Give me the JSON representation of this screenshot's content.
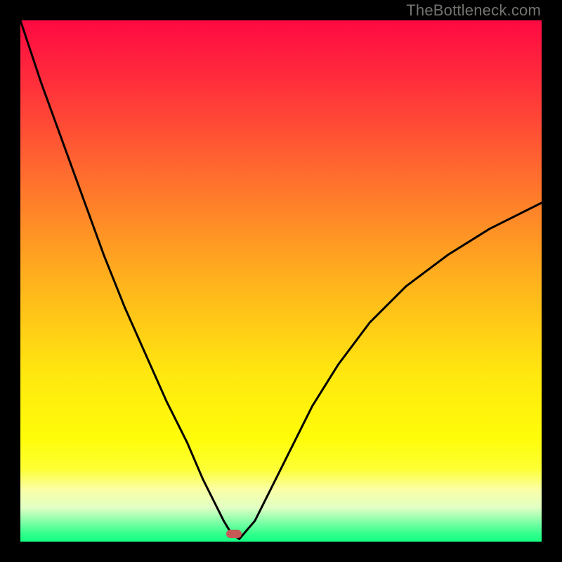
{
  "watermark": "TheBottleneck.com",
  "colors": {
    "frame": "#000000",
    "marker_fill": "#c55a57",
    "curve_stroke": "#000000",
    "gradient_stops": [
      {
        "offset": 0.0,
        "color": "#ff0942"
      },
      {
        "offset": 0.12,
        "color": "#ff2f3b"
      },
      {
        "offset": 0.3,
        "color": "#ff6e2e"
      },
      {
        "offset": 0.5,
        "color": "#ffb21d"
      },
      {
        "offset": 0.68,
        "color": "#ffe80f"
      },
      {
        "offset": 0.8,
        "color": "#fffc09"
      },
      {
        "offset": 0.86,
        "color": "#fdff33"
      },
      {
        "offset": 0.9,
        "color": "#faffa6"
      },
      {
        "offset": 0.935,
        "color": "#e1ffc4"
      },
      {
        "offset": 0.96,
        "color": "#88ffaa"
      },
      {
        "offset": 0.985,
        "color": "#32ff8c"
      },
      {
        "offset": 1.0,
        "color": "#14ff82"
      }
    ]
  },
  "plot": {
    "inner_left": 29,
    "inner_top": 29,
    "inner_width": 742,
    "inner_height": 742
  },
  "chart_data": {
    "type": "line",
    "title": "",
    "xlabel": "",
    "ylabel": "",
    "xlim": [
      0,
      100
    ],
    "ylim": [
      0,
      100
    ],
    "grid": false,
    "legend": false,
    "series": [
      {
        "name": "bottleneck-curve",
        "x": [
          0,
          4,
          8,
          12,
          16,
          20,
          24,
          28,
          32,
          35,
          37,
          39,
          40.5,
          42,
          45,
          48,
          52,
          56,
          61,
          67,
          74,
          82,
          90,
          100
        ],
        "y": [
          100,
          88,
          77,
          66,
          55,
          45,
          36,
          27,
          19,
          12,
          8,
          4,
          1.5,
          0.5,
          4,
          10,
          18,
          26,
          34,
          42,
          49,
          55,
          60,
          65
        ]
      }
    ],
    "marker": {
      "x": 41,
      "y": 1.5,
      "shape": "rounded-rect",
      "color": "#c55a57"
    }
  }
}
